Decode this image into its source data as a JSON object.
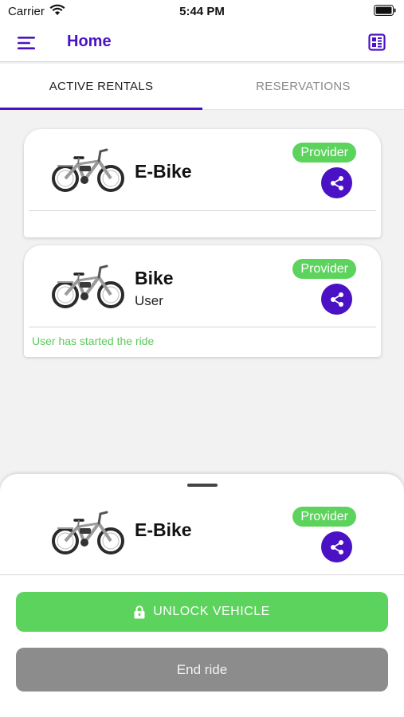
{
  "status_bar": {
    "carrier": "Carrier",
    "time": "5:44 PM"
  },
  "app_bar": {
    "title": "Home",
    "menu_icon": "hamburger-menu-icon",
    "action_icon": "qr-scan-icon"
  },
  "tabs": [
    {
      "label": "ACTIVE RENTALS",
      "active": true
    },
    {
      "label": "RESERVATIONS",
      "active": false
    }
  ],
  "rentals": [
    {
      "name": "E-Bike",
      "subtitle": "",
      "badge": "Provider",
      "status": ""
    },
    {
      "name": "Bike",
      "subtitle": "User",
      "badge": "Provider",
      "status": "User has started the ride"
    }
  ],
  "sheet": {
    "vehicle_name": "E-Bike",
    "badge": "Provider",
    "unlock_label": "UNLOCK VEHICLE",
    "end_label": "End ride"
  },
  "colors": {
    "accent": "#4a12c4",
    "success": "#5cd35c",
    "disabled": "#8c8c8c"
  }
}
